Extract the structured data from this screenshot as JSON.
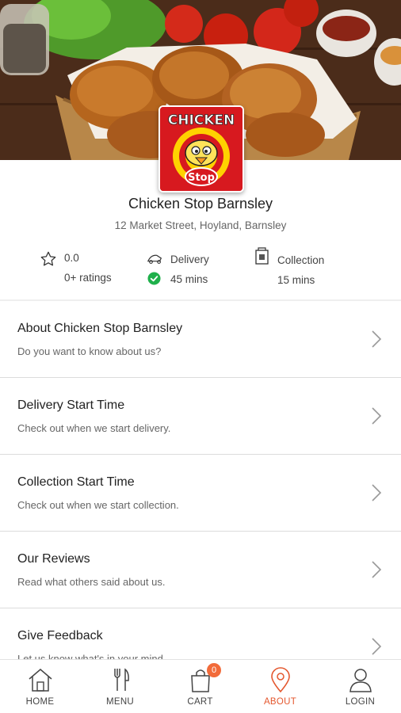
{
  "store": {
    "logo_text_top": "CHICKEN",
    "logo_text_bottom": "Stop",
    "name": "Chicken Stop Barnsley",
    "address": "12 Market Street, Hoyland, Barnsley"
  },
  "stats": {
    "rating_value": "0.0",
    "rating_count": "0+ ratings",
    "delivery_label": "Delivery",
    "delivery_time": "45 mins",
    "collection_label": "Collection",
    "collection_time": "15 mins",
    "status_color": "#1fb04b"
  },
  "menu": [
    {
      "title": "About Chicken Stop Barnsley",
      "subtitle": "Do you want to know about us?"
    },
    {
      "title": "Delivery Start Time",
      "subtitle": "Check out when we start delivery."
    },
    {
      "title": "Collection Start Time",
      "subtitle": "Check out when we start collection."
    },
    {
      "title": "Our Reviews",
      "subtitle": "Read what others said about us."
    },
    {
      "title": "Give Feedback",
      "subtitle": "Let us know what's in your mind"
    }
  ],
  "tabs": [
    {
      "label": "HOME",
      "icon": "home-icon"
    },
    {
      "label": "MENU",
      "icon": "cutlery-icon"
    },
    {
      "label": "CART",
      "icon": "shopping-bag-icon",
      "badge": "0"
    },
    {
      "label": "ABOUT",
      "icon": "location-pin-icon",
      "active": true
    },
    {
      "label": "LOGIN",
      "icon": "user-icon"
    }
  ],
  "colors": {
    "accent": "#e4572e",
    "badge": "#f26b3a",
    "logo_red": "#d7191f",
    "logo_yellow": "#ffd200"
  }
}
